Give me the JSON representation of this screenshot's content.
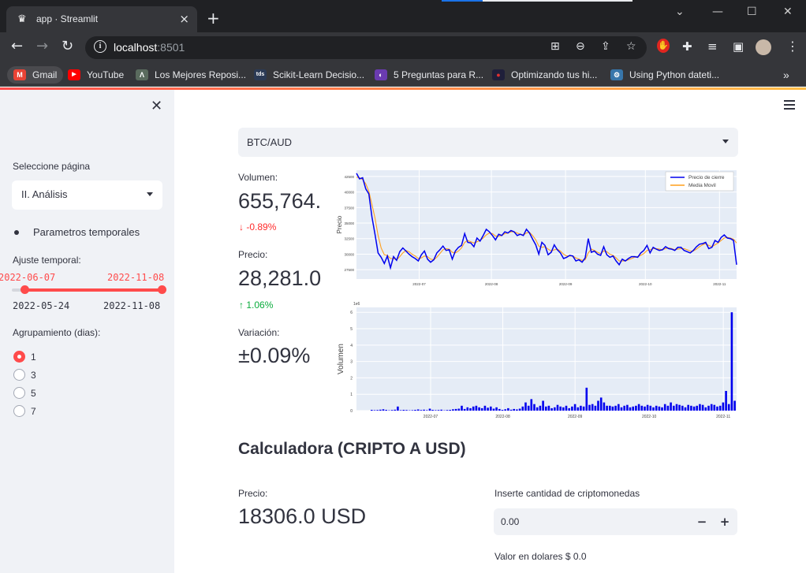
{
  "browser": {
    "tab_title": "app · Streamlit",
    "tab_favicon": "♛",
    "url_host": "localhost",
    "url_port": ":8501",
    "bookmarks": [
      {
        "label": "Gmail",
        "icon": "gmail-icon",
        "color": "#ea4335",
        "glyph": "M"
      },
      {
        "label": "YouTube",
        "icon": "youtube-icon",
        "color": "#ff0000",
        "glyph": "▶"
      },
      {
        "label": "Los Mejores Reposi...",
        "icon": "tri-icon",
        "color": "#5a6b5e",
        "glyph": "Λ"
      },
      {
        "label": "Scikit-Learn Decisio...",
        "icon": "tds-icon",
        "color": "#2b3a55",
        "glyph": "tds"
      },
      {
        "label": "5 Preguntas para R...",
        "icon": "circle-icon",
        "color": "#6a3bb0",
        "glyph": "◐"
      },
      {
        "label": "Optimizando tus hi...",
        "icon": "dot-icon",
        "color": "#1f1f3a",
        "glyph": "●"
      },
      {
        "label": "Using Python dateti...",
        "icon": "python-icon",
        "color": "#3776ab",
        "glyph": "⚙"
      }
    ]
  },
  "sidebar": {
    "page_label": "Seleccione página",
    "page_value": "II. Análisis",
    "bullet": "Parametros temporales",
    "slider_label": "Ajuste temporal:",
    "slider_low": "2022-06-07",
    "slider_high": "2022-11-08",
    "slider_min": "2022-05-24",
    "slider_max": "2022-11-08",
    "group_label": "Agrupamiento (dias):",
    "group_options": [
      "1",
      "3",
      "5",
      "7"
    ],
    "group_selected": "1"
  },
  "main": {
    "pair_select": "BTC/AUD",
    "volume_label": "Volumen:",
    "volume_value": "655,764.",
    "volume_delta": "-0.89%",
    "price_label": "Precio:",
    "price_value": "28,281.0",
    "price_delta": "1.06%",
    "variation_label": "Variación:",
    "variation_value": "±0.09%",
    "calc_title": "Calculadora (CRIPTO A USD)",
    "calc_price_label": "Precio:",
    "calc_price_value": "18306.0 USD",
    "qty_label": "Inserte cantidad de criptomonedas",
    "qty_value": "0.00",
    "usd_result": "Valor en dolares $ 0.0"
  },
  "chart_data": [
    {
      "type": "line",
      "ylabel": "Precio",
      "x_ticks": [
        "2022-07",
        "2022-08",
        "2022-09",
        "2022-10",
        "2022-11"
      ],
      "y_ticks": [
        27500,
        30000,
        32500,
        35000,
        37500,
        40000,
        42500
      ],
      "ylim": [
        26000,
        43500
      ],
      "series": [
        {
          "name": "Precio de cierre",
          "color": "#0000ee",
          "values": [
            43000,
            42100,
            42300,
            40500,
            39700,
            36000,
            33200,
            30200,
            29500,
            28500,
            29700,
            27800,
            29600,
            29000,
            30400,
            31000,
            30500,
            30000,
            29600,
            29300,
            28900,
            29900,
            30500,
            29200,
            28700,
            29100,
            30200,
            30700,
            31300,
            30600,
            30700,
            29200,
            30500,
            31100,
            31400,
            33300,
            31900,
            31800,
            31200,
            32600,
            32100,
            33000,
            34000,
            33600,
            33000,
            32300,
            33200,
            33000,
            33600,
            33400,
            33800,
            33600,
            33000,
            33200,
            33000,
            34000,
            33400,
            32400,
            31500,
            30000,
            31900,
            31400,
            29900,
            30300,
            31500,
            30700,
            30200,
            29300,
            29500,
            29800,
            29700,
            28900,
            29100,
            28700,
            29400,
            32500,
            30300,
            30500,
            30000,
            29800,
            31200,
            29900,
            29500,
            29700,
            28900,
            28300,
            29200,
            28900,
            29300,
            29600,
            29600,
            29500,
            30200,
            30600,
            31400,
            30200,
            31100,
            30800,
            30600,
            30700,
            31200,
            30900,
            30800,
            30600,
            31100,
            31100,
            30600,
            30400,
            30200,
            30600,
            31200,
            31600,
            31700,
            31900,
            30900,
            31100,
            32200,
            31900,
            32700,
            33100,
            32600,
            32500,
            32200,
            28300
          ]
        },
        {
          "name": "Media Movil",
          "color": "#ff9f1c",
          "values": [
            42400,
            42300,
            42000,
            41300,
            40100,
            38000,
            35800,
            33000,
            31000,
            29900,
            29800,
            29300,
            29300,
            29100,
            29600,
            30200,
            30600,
            30400,
            30000,
            29700,
            29300,
            29400,
            29700,
            29600,
            29200,
            29100,
            29500,
            30100,
            30700,
            30900,
            30800,
            30300,
            30200,
            30500,
            31000,
            31900,
            32200,
            32000,
            31800,
            32000,
            32200,
            32600,
            33100,
            33400,
            33300,
            32900,
            32900,
            33000,
            33300,
            33400,
            33600,
            33600,
            33400,
            33200,
            33100,
            33400,
            33500,
            33000,
            32300,
            31300,
            31100,
            31200,
            30800,
            30500,
            30700,
            30800,
            30500,
            30000,
            29700,
            29700,
            29700,
            29400,
            29200,
            29000,
            29100,
            30200,
            30800,
            30600,
            30300,
            30100,
            30500,
            30400,
            30000,
            29800,
            29400,
            28900,
            28900,
            28900,
            29100,
            29300,
            29500,
            29600,
            29800,
            30100,
            30600,
            30700,
            30900,
            30900,
            30800,
            30700,
            30900,
            31000,
            30900,
            30700,
            30800,
            30900,
            30900,
            30700,
            30500,
            30500,
            30800,
            31200,
            31500,
            31700,
            31400,
            31200,
            31500,
            31800,
            32200,
            32600,
            32700,
            32600,
            32400,
            31800
          ]
        }
      ]
    },
    {
      "type": "bar",
      "ylabel": "Volumen",
      "y_multiplier": "1e6",
      "x_ticks": [
        "2022-07",
        "2022-08",
        "2022-09",
        "2022-10",
        "2022-11"
      ],
      "y_ticks": [
        0,
        1,
        2,
        3,
        4,
        5,
        6
      ],
      "ylim": [
        0,
        6.3
      ],
      "color": "#0000ee",
      "values": [
        0.05,
        0.03,
        0.04,
        0.06,
        0.08,
        0.05,
        0.02,
        0.04,
        0.06,
        0.25,
        0.03,
        0.05,
        0.04,
        0.02,
        0.03,
        0.05,
        0.07,
        0.04,
        0.06,
        0.03,
        0.12,
        0.05,
        0.03,
        0.04,
        0.06,
        0.02,
        0.04,
        0.05,
        0.08,
        0.1,
        0.12,
        0.3,
        0.1,
        0.2,
        0.15,
        0.25,
        0.3,
        0.2,
        0.15,
        0.3,
        0.18,
        0.25,
        0.12,
        0.2,
        0.1,
        0.05,
        0.08,
        0.15,
        0.06,
        0.1,
        0.07,
        0.12,
        0.25,
        0.5,
        0.3,
        0.7,
        0.4,
        0.2,
        0.3,
        0.6,
        0.25,
        0.3,
        0.15,
        0.2,
        0.35,
        0.25,
        0.2,
        0.3,
        0.15,
        0.25,
        0.4,
        0.2,
        0.3,
        0.25,
        1.4,
        0.35,
        0.4,
        0.3,
        0.6,
        0.8,
        0.5,
        0.3,
        0.3,
        0.25,
        0.3,
        0.4,
        0.2,
        0.3,
        0.35,
        0.2,
        0.25,
        0.3,
        0.4,
        0.3,
        0.25,
        0.35,
        0.3,
        0.2,
        0.3,
        0.25,
        0.2,
        0.4,
        0.3,
        0.5,
        0.3,
        0.4,
        0.35,
        0.3,
        0.2,
        0.35,
        0.3,
        0.25,
        0.3,
        0.4,
        0.35,
        0.2,
        0.3,
        0.4,
        0.35,
        0.25,
        0.3,
        0.5,
        1.2,
        0.4,
        6.0,
        0.6
      ]
    }
  ]
}
